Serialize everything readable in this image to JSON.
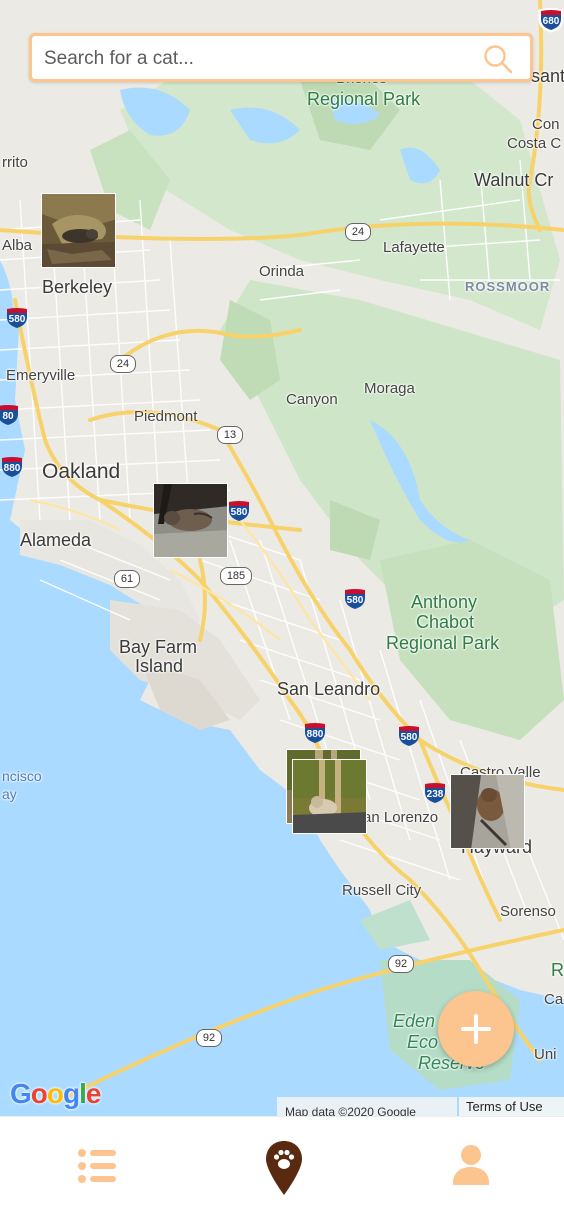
{
  "search": {
    "placeholder": "Search for a cat..."
  },
  "map": {
    "places": {
      "briones": "Regional Park",
      "briones_top": "Briones",
      "santa": "santa",
      "contra": "Con",
      "costa": "Costa C",
      "walnut": "Walnut Cr",
      "cerrito": "rrito",
      "albany": "Alba",
      "lafayette": "Lafayette",
      "orinda": "Orinda",
      "rossmoor": "ROSSMOOR",
      "berkeley": "Berkeley",
      "emeryville": "Emeryville",
      "moraga": "Moraga",
      "piedmont": "Piedmont",
      "canyon": "Canyon",
      "oakland": "Oakland",
      "alameda": "Alameda",
      "anthony_1": "Anthony",
      "anthony_2": "Chabot",
      "anthony_3": "Regional Park",
      "bayfarm_1": "Bay Farm",
      "bayfarm_2": "Island",
      "sanleandro": "San Leandro",
      "francisco_1": "ncisco",
      "francisco_2": "ay",
      "castro": "Castro Valle",
      "sanlorenzo": "an Lorenzo",
      "hayward": "Hayward",
      "russell": "Russell City",
      "sorenso": "Sorenso",
      "r_edge": "R",
      "ca_edge": "Ca",
      "uni_edge": "Uni",
      "eden_1": "Eden",
      "eden_2": "Eco",
      "eden_3": "Reserve"
    },
    "routes": {
      "r680_top": "680",
      "r24_a": "24",
      "r580_a": "580",
      "r24_b": "24",
      "r80": "80",
      "r880_a": "880",
      "r13": "13",
      "r580_b": "580",
      "r61": "61",
      "r185": "185",
      "r580_c": "580",
      "r880_b": "880",
      "r580_d": "580",
      "r238": "238",
      "r92_a": "92",
      "r92_b": "92"
    },
    "google_logo": "Google",
    "attribution": "Map data ©2020 Google",
    "terms": "Terms of Use"
  },
  "markers": [
    {
      "name": "cat-marker-berkeley"
    },
    {
      "name": "cat-marker-oakland"
    },
    {
      "name": "cat-marker-san-leandro-1"
    },
    {
      "name": "cat-marker-san-leandro-2"
    },
    {
      "name": "cat-marker-hayward"
    }
  ],
  "colors": {
    "accent": "#fcc48f",
    "nav_active": "#5a2a10",
    "nav_inactive": "#fcc48f",
    "water": "#aadaff",
    "land": "#eceae4",
    "park": "#c8e2c0"
  },
  "nav": {
    "items": [
      {
        "icon": "list-icon",
        "active": false
      },
      {
        "icon": "paw-location-icon",
        "active": true
      },
      {
        "icon": "user-icon",
        "active": false
      }
    ]
  }
}
